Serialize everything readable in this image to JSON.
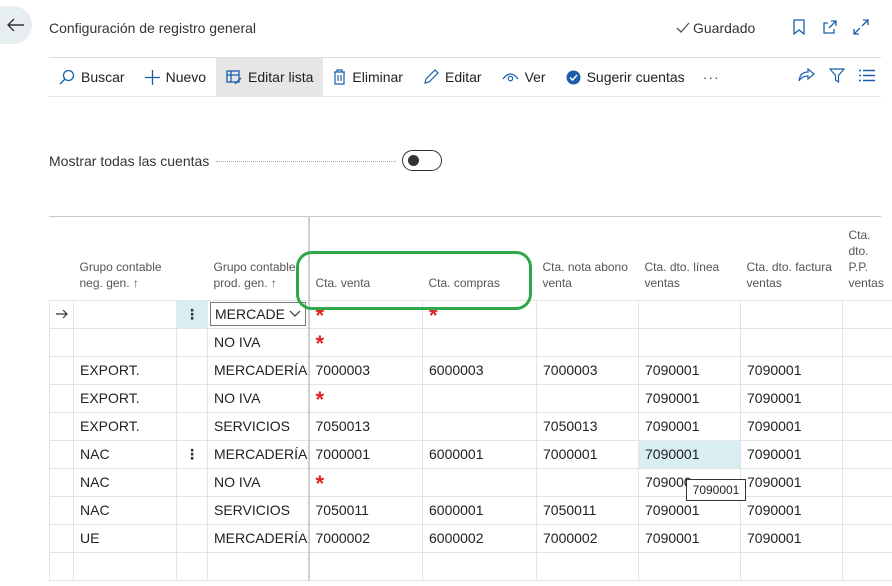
{
  "header": {
    "title": "Configuración de registro general",
    "saved_label": "Guardado"
  },
  "actions": {
    "buscar": "Buscar",
    "nuevo": "Nuevo",
    "editar_lista": "Editar lista",
    "eliminar": "Eliminar",
    "editar": "Editar",
    "ver": "Ver",
    "sugerir": "Sugerir cuentas",
    "more": "···"
  },
  "filter": {
    "show_all_label": "Mostrar todas las cuentas",
    "show_all_value": false
  },
  "table": {
    "headers": {
      "grupo_neg": "Grupo contable neg. gen. ↑",
      "grupo_prod": "Grupo contable prod. gen. ↑",
      "cta_venta": "Cta. venta",
      "cta_compras": "Cta. compras",
      "cta_nota": "Cta. nota abono venta",
      "cta_dto_linea": "Cta. dto. línea ventas",
      "cta_dto_factura": "Cta. dto. factura ventas",
      "cta_dto_pp": "Cta. dto. P.P. ventas"
    },
    "rows": [
      {
        "neg": "",
        "prod": "MERCADE",
        "venta": "",
        "compras": "",
        "nota": "",
        "linea": "",
        "factura": ""
      },
      {
        "neg": "",
        "prod": "NO IVA",
        "venta": "",
        "compras": "",
        "nota": "",
        "linea": "",
        "factura": ""
      },
      {
        "neg": "EXPORT.",
        "prod": "MERCADERÍA",
        "venta": "7000003",
        "compras": "6000003",
        "nota": "7000003",
        "linea": "7090001",
        "factura": "7090001"
      },
      {
        "neg": "EXPORT.",
        "prod": "NO IVA",
        "venta": "",
        "compras": "",
        "nota": "",
        "linea": "7090001",
        "factura": "7090001"
      },
      {
        "neg": "EXPORT.",
        "prod": "SERVICIOS",
        "venta": "7050013",
        "compras": "",
        "nota": "7050013",
        "linea": "7090001",
        "factura": "7090001"
      },
      {
        "neg": "NAC",
        "prod": "MERCADERÍA",
        "venta": "7000001",
        "compras": "6000001",
        "nota": "7000001",
        "linea": "7090001",
        "factura": "7090001"
      },
      {
        "neg": "NAC",
        "prod": "NO IVA",
        "venta": "",
        "compras": "",
        "nota": "",
        "linea": "709000",
        "factura": "7090001"
      },
      {
        "neg": "NAC",
        "prod": "SERVICIOS",
        "venta": "7050011",
        "compras": "6000001",
        "nota": "7050011",
        "linea": "7090001",
        "factura": "7090001"
      },
      {
        "neg": "UE",
        "prod": "MERCADERÍA",
        "venta": "7000002",
        "compras": "6000002",
        "nota": "7000002",
        "linea": "7090001",
        "factura": "7090001"
      }
    ],
    "required_mark": "*",
    "tooltip": "7090001"
  }
}
